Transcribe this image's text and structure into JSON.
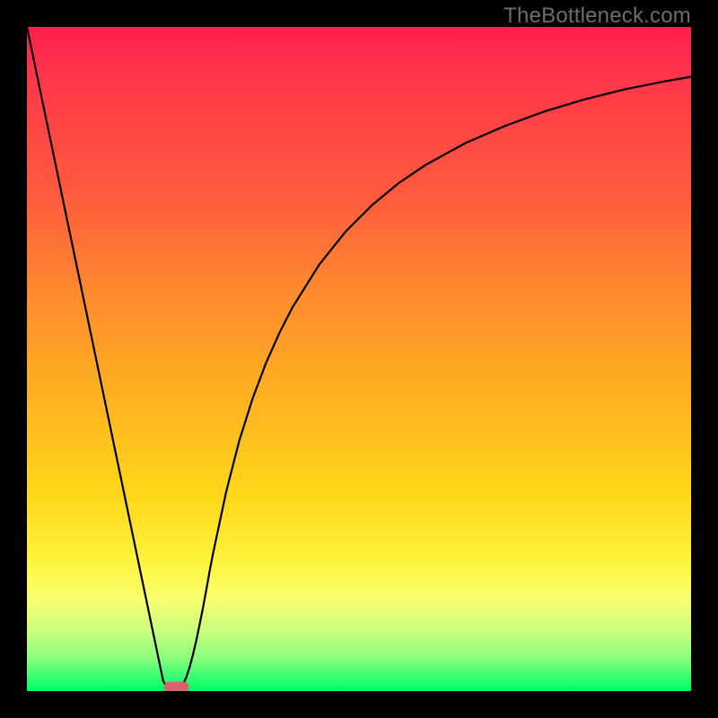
{
  "watermark": "TheBottleneck.com",
  "chart_data": {
    "type": "line",
    "title": "",
    "xlabel": "",
    "ylabel": "",
    "xlim": [
      0,
      100
    ],
    "ylim": [
      0,
      100
    ],
    "grid": false,
    "series": [
      {
        "name": "bottleneck-curve",
        "color": "#000000",
        "x": [
          0,
          2,
          4,
          6,
          8,
          10,
          12,
          14,
          16,
          18,
          20,
          20.5,
          21,
          21.5,
          22,
          22.5,
          23,
          23.5,
          24,
          24.5,
          25,
          25.5,
          26,
          26.5,
          27,
          27.5,
          28,
          30,
          32,
          34,
          36,
          38,
          40,
          44,
          48,
          52,
          56,
          60,
          66,
          72,
          78,
          84,
          90,
          96,
          100
        ],
        "values": [
          100,
          90.4,
          80.8,
          71.2,
          61.6,
          52,
          42.4,
          32.8,
          23.2,
          13.6,
          4,
          1.6,
          0.6,
          0.1,
          0,
          0.1,
          0.4,
          1.0,
          2.1,
          3.6,
          5.5,
          7.6,
          10.0,
          12.5,
          15.2,
          18.0,
          20.6,
          30.0,
          37.8,
          44.1,
          49.4,
          53.9,
          57.8,
          64.2,
          69.2,
          73.2,
          76.5,
          79.2,
          82.5,
          85.1,
          87.3,
          89.1,
          90.6,
          91.8,
          92.5
        ]
      }
    ],
    "background_gradient": {
      "direction": "vertical",
      "stops": [
        {
          "pos": 0.0,
          "color": "#ff1f4d"
        },
        {
          "pos": 0.08,
          "color": "#ff3749"
        },
        {
          "pos": 0.25,
          "color": "#ff5a3e"
        },
        {
          "pos": 0.4,
          "color": "#ff8a2e"
        },
        {
          "pos": 0.55,
          "color": "#ffb021"
        },
        {
          "pos": 0.7,
          "color": "#ffd61a"
        },
        {
          "pos": 0.8,
          "color": "#fff23a"
        },
        {
          "pos": 0.86,
          "color": "#fbff6e"
        },
        {
          "pos": 0.91,
          "color": "#c9ff7d"
        },
        {
          "pos": 0.95,
          "color": "#8cff7d"
        },
        {
          "pos": 0.98,
          "color": "#34ff72"
        },
        {
          "pos": 1.0,
          "color": "#00ff66"
        }
      ]
    },
    "marker": {
      "shape": "rounded-pill",
      "x_center": 22.5,
      "y_center": 0.6,
      "width_units": 3.8,
      "height_units": 1.6,
      "color": "#d9636c"
    },
    "solid_bands": [
      {
        "y_from": 0,
        "y_to": 0.6,
        "color": "#00ff66"
      }
    ]
  }
}
